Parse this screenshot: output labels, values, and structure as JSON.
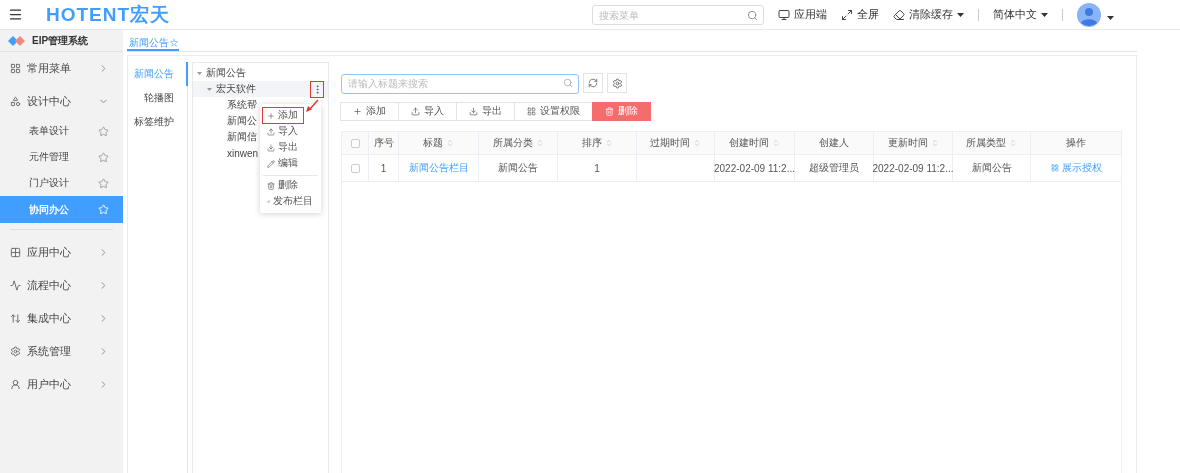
{
  "header": {
    "logo": "HOTENT宏天",
    "search": {
      "placeholder": "搜索菜单"
    },
    "actions": [
      {
        "label": "应用端",
        "dropdown": false
      },
      {
        "label": "全屏",
        "dropdown": false
      },
      {
        "label": "清除缓存",
        "dropdown": true
      }
    ],
    "language": {
      "label": "简体中文"
    }
  },
  "sidebar": {
    "title": "EIP管理系统",
    "items": [
      {
        "label": "常用菜单",
        "expanded": false,
        "selected": false
      },
      {
        "label": "设计中心",
        "expanded": true,
        "selected": false,
        "children": [
          {
            "label": "表单设计",
            "selected": false
          },
          {
            "label": "元件管理",
            "selected": false
          },
          {
            "label": "门户设计",
            "selected": false
          },
          {
            "label": "协同办公",
            "selected": true
          }
        ]
      },
      {
        "label": "应用中心",
        "expanded": false,
        "selected": false
      },
      {
        "label": "流程中心",
        "expanded": false,
        "selected": false
      },
      {
        "label": "集成中心",
        "expanded": false,
        "selected": false
      },
      {
        "label": "系统管理",
        "expanded": false,
        "selected": false
      },
      {
        "label": "用户中心",
        "expanded": false,
        "selected": false
      }
    ]
  },
  "page_tabs": [
    {
      "label": "新闻公告☆",
      "selected": true
    }
  ],
  "side_tabs": [
    {
      "label": "新闻公告",
      "selected": true
    },
    {
      "label": "轮播图",
      "selected": false
    },
    {
      "label": "标签维护",
      "selected": false
    }
  ],
  "tree": [
    {
      "label": "新闻公告",
      "expanded": true,
      "selected": false,
      "children": [
        {
          "label": "宏天软件",
          "expanded": true,
          "selected": true,
          "highlighted": true,
          "children": [
            {
              "label": "系统帮",
              "selected": false
            },
            {
              "label": "新闻公",
              "selected": false
            },
            {
              "label": "新闻信",
              "selected": false
            },
            {
              "label": "xinwen",
              "selected": false
            }
          ]
        }
      ]
    }
  ],
  "context_menu": [
    {
      "label": "添加",
      "highlighted": true,
      "divider_before": false
    },
    {
      "label": "导入",
      "highlighted": false,
      "divider_before": false
    },
    {
      "label": "导出",
      "highlighted": false,
      "divider_before": false
    },
    {
      "label": "编辑",
      "highlighted": false,
      "divider_before": false
    },
    {
      "label": "删除",
      "highlighted": false,
      "divider_before": true
    },
    {
      "label": "发布栏目",
      "highlighted": false,
      "divider_before": false
    }
  ],
  "search": {
    "placeholder": "请输入标题来搜索"
  },
  "toolbar": [
    {
      "label": "添加",
      "kind": "default"
    },
    {
      "label": "导入",
      "kind": "default"
    },
    {
      "label": "导出",
      "kind": "default"
    },
    {
      "label": "设置权限",
      "kind": "default"
    },
    {
      "label": "删除",
      "kind": "danger"
    }
  ],
  "table": {
    "columns": [
      {
        "label": "序号",
        "sortable": false
      },
      {
        "label": "标题",
        "sortable": true
      },
      {
        "label": "所属分类",
        "sortable": true
      },
      {
        "label": "排序",
        "sortable": true
      },
      {
        "label": "过期时间",
        "sortable": true
      },
      {
        "label": "创建时间",
        "sortable": true
      },
      {
        "label": "创建人",
        "sortable": false
      },
      {
        "label": "更新时间",
        "sortable": true
      },
      {
        "label": "所属类型",
        "sortable": true
      },
      {
        "label": "操作",
        "sortable": false
      }
    ],
    "header_checked": false,
    "rows": [
      {
        "checked": false,
        "cells": [
          "1",
          "新闻公告栏目",
          "新闻公告",
          "1",
          "",
          "2022-02-09 11:2...",
          "超级管理员",
          "2022-02-09 11:2...",
          "新闻公告"
        ],
        "action": "展示授权"
      }
    ]
  }
}
